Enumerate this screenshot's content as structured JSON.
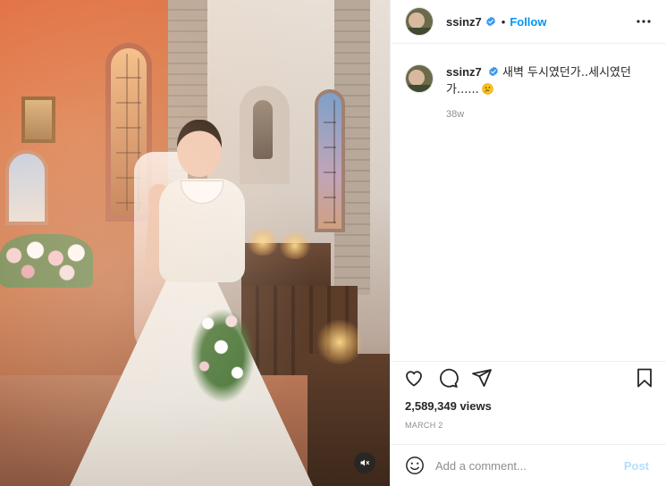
{
  "post": {
    "username": "ssinz7",
    "verified": true,
    "follow_label": "Follow",
    "header_separator": "•"
  },
  "caption": {
    "username": "ssinz7",
    "text": "새벽 두시였던가..세시였던가......",
    "emoji": "thinking-face",
    "time_ago": "38w"
  },
  "stats": {
    "views": "2,589,349 views",
    "date": "MARCH 2"
  },
  "comment": {
    "placeholder": "Add a comment...",
    "post_label": "Post"
  },
  "media": {
    "type": "video",
    "description": "bride in white gown with veil and bouquet inside a chapel",
    "audio": "muted"
  },
  "colors": {
    "link_blue": "#0095f6",
    "post_disabled": "#b2dffc",
    "verified_blue": "#3897f0",
    "muted_text": "#8e8e8e"
  }
}
